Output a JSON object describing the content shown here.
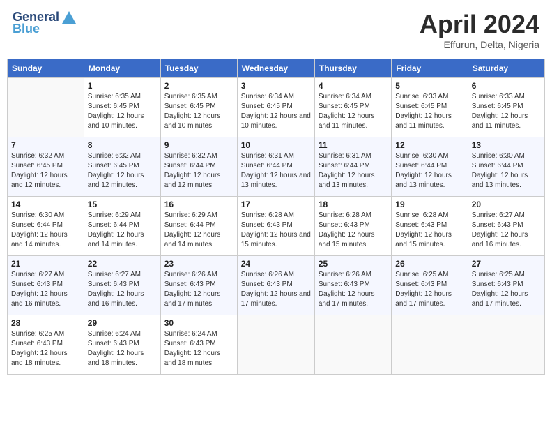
{
  "header": {
    "logo_general": "General",
    "logo_blue": "Blue",
    "month": "April 2024",
    "location": "Effurun, Delta, Nigeria"
  },
  "days_of_week": [
    "Sunday",
    "Monday",
    "Tuesday",
    "Wednesday",
    "Thursday",
    "Friday",
    "Saturday"
  ],
  "weeks": [
    [
      {
        "day": "",
        "sunrise": "",
        "sunset": "",
        "daylight": ""
      },
      {
        "day": "1",
        "sunrise": "Sunrise: 6:35 AM",
        "sunset": "Sunset: 6:45 PM",
        "daylight": "Daylight: 12 hours and 10 minutes."
      },
      {
        "day": "2",
        "sunrise": "Sunrise: 6:35 AM",
        "sunset": "Sunset: 6:45 PM",
        "daylight": "Daylight: 12 hours and 10 minutes."
      },
      {
        "day": "3",
        "sunrise": "Sunrise: 6:34 AM",
        "sunset": "Sunset: 6:45 PM",
        "daylight": "Daylight: 12 hours and 10 minutes."
      },
      {
        "day": "4",
        "sunrise": "Sunrise: 6:34 AM",
        "sunset": "Sunset: 6:45 PM",
        "daylight": "Daylight: 12 hours and 11 minutes."
      },
      {
        "day": "5",
        "sunrise": "Sunrise: 6:33 AM",
        "sunset": "Sunset: 6:45 PM",
        "daylight": "Daylight: 12 hours and 11 minutes."
      },
      {
        "day": "6",
        "sunrise": "Sunrise: 6:33 AM",
        "sunset": "Sunset: 6:45 PM",
        "daylight": "Daylight: 12 hours and 11 minutes."
      }
    ],
    [
      {
        "day": "7",
        "sunrise": "Sunrise: 6:32 AM",
        "sunset": "Sunset: 6:45 PM",
        "daylight": "Daylight: 12 hours and 12 minutes."
      },
      {
        "day": "8",
        "sunrise": "Sunrise: 6:32 AM",
        "sunset": "Sunset: 6:45 PM",
        "daylight": "Daylight: 12 hours and 12 minutes."
      },
      {
        "day": "9",
        "sunrise": "Sunrise: 6:32 AM",
        "sunset": "Sunset: 6:44 PM",
        "daylight": "Daylight: 12 hours and 12 minutes."
      },
      {
        "day": "10",
        "sunrise": "Sunrise: 6:31 AM",
        "sunset": "Sunset: 6:44 PM",
        "daylight": "Daylight: 12 hours and 13 minutes."
      },
      {
        "day": "11",
        "sunrise": "Sunrise: 6:31 AM",
        "sunset": "Sunset: 6:44 PM",
        "daylight": "Daylight: 12 hours and 13 minutes."
      },
      {
        "day": "12",
        "sunrise": "Sunrise: 6:30 AM",
        "sunset": "Sunset: 6:44 PM",
        "daylight": "Daylight: 12 hours and 13 minutes."
      },
      {
        "day": "13",
        "sunrise": "Sunrise: 6:30 AM",
        "sunset": "Sunset: 6:44 PM",
        "daylight": "Daylight: 12 hours and 13 minutes."
      }
    ],
    [
      {
        "day": "14",
        "sunrise": "Sunrise: 6:30 AM",
        "sunset": "Sunset: 6:44 PM",
        "daylight": "Daylight: 12 hours and 14 minutes."
      },
      {
        "day": "15",
        "sunrise": "Sunrise: 6:29 AM",
        "sunset": "Sunset: 6:44 PM",
        "daylight": "Daylight: 12 hours and 14 minutes."
      },
      {
        "day": "16",
        "sunrise": "Sunrise: 6:29 AM",
        "sunset": "Sunset: 6:44 PM",
        "daylight": "Daylight: 12 hours and 14 minutes."
      },
      {
        "day": "17",
        "sunrise": "Sunrise: 6:28 AM",
        "sunset": "Sunset: 6:43 PM",
        "daylight": "Daylight: 12 hours and 15 minutes."
      },
      {
        "day": "18",
        "sunrise": "Sunrise: 6:28 AM",
        "sunset": "Sunset: 6:43 PM",
        "daylight": "Daylight: 12 hours and 15 minutes."
      },
      {
        "day": "19",
        "sunrise": "Sunrise: 6:28 AM",
        "sunset": "Sunset: 6:43 PM",
        "daylight": "Daylight: 12 hours and 15 minutes."
      },
      {
        "day": "20",
        "sunrise": "Sunrise: 6:27 AM",
        "sunset": "Sunset: 6:43 PM",
        "daylight": "Daylight: 12 hours and 16 minutes."
      }
    ],
    [
      {
        "day": "21",
        "sunrise": "Sunrise: 6:27 AM",
        "sunset": "Sunset: 6:43 PM",
        "daylight": "Daylight: 12 hours and 16 minutes."
      },
      {
        "day": "22",
        "sunrise": "Sunrise: 6:27 AM",
        "sunset": "Sunset: 6:43 PM",
        "daylight": "Daylight: 12 hours and 16 minutes."
      },
      {
        "day": "23",
        "sunrise": "Sunrise: 6:26 AM",
        "sunset": "Sunset: 6:43 PM",
        "daylight": "Daylight: 12 hours and 17 minutes."
      },
      {
        "day": "24",
        "sunrise": "Sunrise: 6:26 AM",
        "sunset": "Sunset: 6:43 PM",
        "daylight": "Daylight: 12 hours and 17 minutes."
      },
      {
        "day": "25",
        "sunrise": "Sunrise: 6:26 AM",
        "sunset": "Sunset: 6:43 PM",
        "daylight": "Daylight: 12 hours and 17 minutes."
      },
      {
        "day": "26",
        "sunrise": "Sunrise: 6:25 AM",
        "sunset": "Sunset: 6:43 PM",
        "daylight": "Daylight: 12 hours and 17 minutes."
      },
      {
        "day": "27",
        "sunrise": "Sunrise: 6:25 AM",
        "sunset": "Sunset: 6:43 PM",
        "daylight": "Daylight: 12 hours and 17 minutes."
      }
    ],
    [
      {
        "day": "28",
        "sunrise": "Sunrise: 6:25 AM",
        "sunset": "Sunset: 6:43 PM",
        "daylight": "Daylight: 12 hours and 18 minutes."
      },
      {
        "day": "29",
        "sunrise": "Sunrise: 6:24 AM",
        "sunset": "Sunset: 6:43 PM",
        "daylight": "Daylight: 12 hours and 18 minutes."
      },
      {
        "day": "30",
        "sunrise": "Sunrise: 6:24 AM",
        "sunset": "Sunset: 6:43 PM",
        "daylight": "Daylight: 12 hours and 18 minutes."
      },
      {
        "day": "",
        "sunrise": "",
        "sunset": "",
        "daylight": ""
      },
      {
        "day": "",
        "sunrise": "",
        "sunset": "",
        "daylight": ""
      },
      {
        "day": "",
        "sunrise": "",
        "sunset": "",
        "daylight": ""
      },
      {
        "day": "",
        "sunrise": "",
        "sunset": "",
        "daylight": ""
      }
    ]
  ]
}
